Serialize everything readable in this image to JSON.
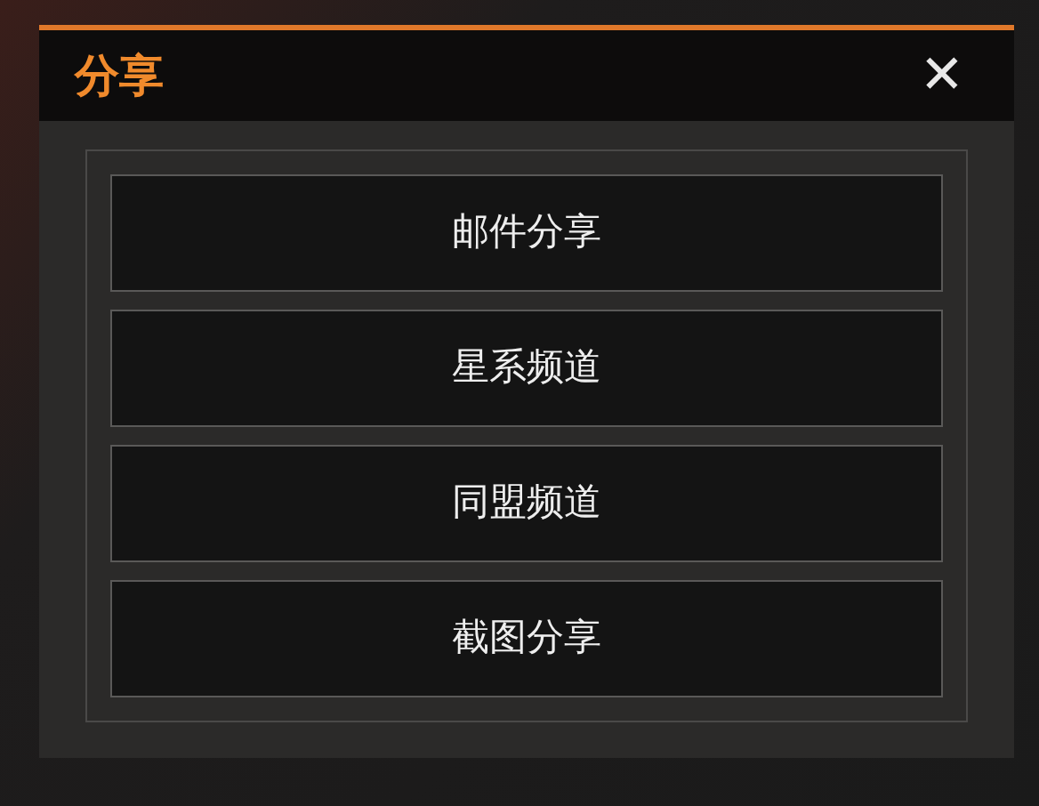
{
  "dialog": {
    "title": "分享",
    "close": "✕"
  },
  "options": [
    {
      "label": "邮件分享"
    },
    {
      "label": "星系频道"
    },
    {
      "label": "同盟频道"
    },
    {
      "label": "截图分享"
    }
  ]
}
